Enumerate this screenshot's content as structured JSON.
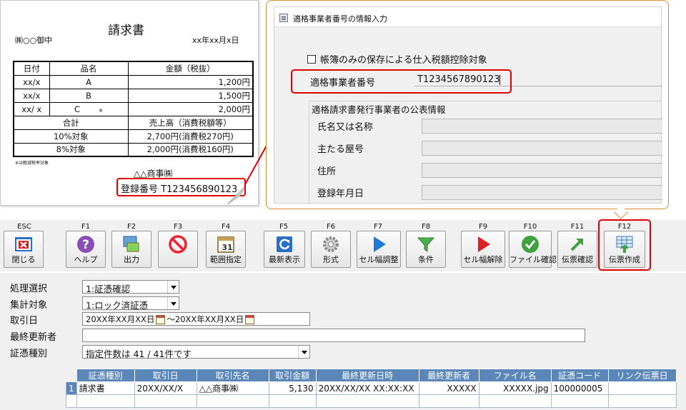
{
  "invoice": {
    "title": "請求書",
    "recipient": "㈱○○御中",
    "date": "xx年xx月x日",
    "headers": [
      "日付",
      "品名",
      "金額（税抜）"
    ],
    "rows": [
      {
        "date": "xx/x",
        "item": "A",
        "mark": "",
        "amount": "1,200円"
      },
      {
        "date": "xx/x",
        "item": "B",
        "mark": "",
        "amount": "1,500円"
      },
      {
        "date": "xx/ x",
        "item": "C",
        "mark": "※",
        "amount": "2,000円"
      }
    ],
    "total_label": "合計",
    "sales_label": "売上高（消費税額等）",
    "tax10_label": "10%対象",
    "tax10_value": "2,700円(消費税270円)",
    "tax8_label": "8%対象",
    "tax8_value": "2,000円(消費税160円)",
    "note": "※は軽減税率対象",
    "seller": "△△商事㈱",
    "registration": "登録番号 T1234568901​23"
  },
  "dialog": {
    "title": "適格事業者番号の情報入力",
    "checkbox_label": "帳簿のみの保存による仕入税額控除対象",
    "reg_label": "適格事業者番号",
    "reg_value": "T1234567890123",
    "group_title": "適格請求書発行事業者の公表情報",
    "fields": [
      "氏名又は名称",
      "主たる屋号",
      "住所",
      "登録年月日"
    ]
  },
  "toolbar": [
    {
      "key": "ESC",
      "label": "閉じる",
      "icon": "close-icon"
    },
    {
      "key": "F1",
      "label": "ヘルプ",
      "icon": "help-icon"
    },
    {
      "key": "F2",
      "label": "出力",
      "icon": "output-icon"
    },
    {
      "key": "F3",
      "label": "",
      "icon": "prohibit-icon"
    },
    {
      "key": "F4",
      "label": "範囲指定",
      "icon": "calendar-icon"
    },
    {
      "key": "F5",
      "label": "最新表示",
      "icon": "refresh-icon"
    },
    {
      "key": "F6",
      "label": "形式",
      "icon": "gear-icon"
    },
    {
      "key": "F7",
      "label": "セル幅調整",
      "icon": "play-blue-icon"
    },
    {
      "key": "F8",
      "label": "条件",
      "icon": "filter-icon"
    },
    {
      "key": "F9",
      "label": "セル幅解除",
      "icon": "play-red-icon"
    },
    {
      "key": "F10",
      "label": "ファイル確認",
      "icon": "check-icon"
    },
    {
      "key": "F11",
      "label": "伝票確認",
      "icon": "arrow-icon"
    },
    {
      "key": "F12",
      "label": "伝票作成",
      "icon": "create-slip-icon"
    }
  ],
  "form": {
    "process_label": "処理選択",
    "process_value": "1:証憑確認",
    "aggregate_label": "集計対象",
    "aggregate_value": "1:ロック済証憑",
    "date_label": "取引日",
    "date_from": "20XX年XX月XX日",
    "date_sep": "～",
    "date_to": "20XX年XX月XX日",
    "updater_label": "最終更新者",
    "updater_value": "",
    "type_label": "証憑種別",
    "type_value": "指定件数は 41 / 41件です"
  },
  "grid": {
    "headers": [
      "証憑種別",
      "取引日",
      "取引先名",
      "取引金額",
      "最終更新日時",
      "最終更新者",
      "ファイル名",
      "証憑コード",
      "リンク伝票日"
    ],
    "rows": [
      {
        "num": "1",
        "cells": [
          "請求書",
          "20XX/XX/X",
          "△△商事㈱",
          "5,130",
          "20XX/XX/XX XX:XX:XX",
          "XXXXX",
          "XXXXX.jpg",
          "100000005",
          ""
        ]
      }
    ]
  }
}
